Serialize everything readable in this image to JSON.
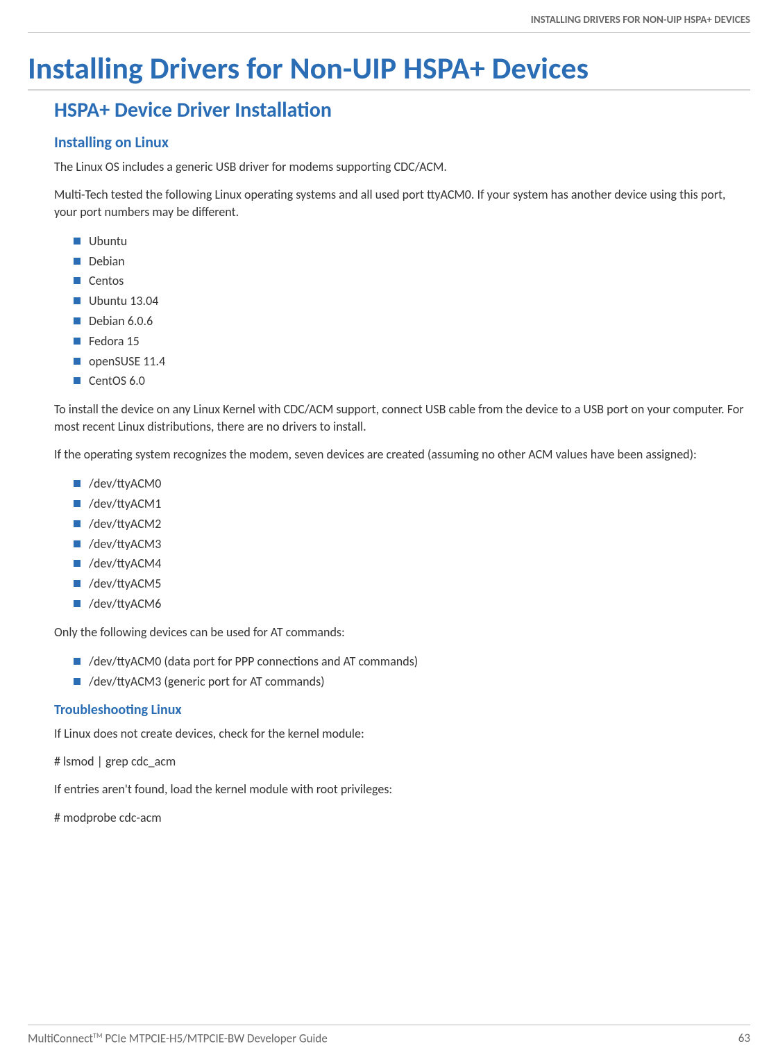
{
  "header": "INSTALLING DRIVERS FOR NON-UIP HSPA+ DEVICES",
  "title": "Installing Drivers for Non-UIP HSPA+ Devices",
  "section_heading": "HSPA+ Device Driver Installation",
  "subheading1": "Installing on Linux",
  "para1": "The Linux OS includes a generic USB driver for modems supporting CDC/ACM.",
  "para2": "Multi-Tech tested the following Linux operating systems and all used port ttyACM0. If your system has another device using this port, your port numbers may be different.",
  "os_list": [
    "Ubuntu",
    "Debian",
    "Centos",
    "Ubuntu 13.04",
    "Debian 6.0.6",
    "Fedora 15",
    "openSUSE 11.4",
    "CentOS 6.0"
  ],
  "para3": "To install the device on any Linux Kernel with CDC/ACM support, connect USB cable from the device to a USB port on your computer. For most recent Linux distributions, there are no drivers to install.",
  "para4": "If the operating system recognizes the modem, seven devices are created (assuming no other ACM values have been assigned):",
  "dev_list": [
    "/dev/ttyACM0",
    "/dev/ttyACM1",
    "/dev/ttyACM2",
    "/dev/ttyACM3",
    "/dev/ttyACM4",
    "/dev/ttyACM5",
    "/dev/ttyACM6"
  ],
  "para5": "Only the following devices can be used for AT commands:",
  "at_list": [
    "/dev/ttyACM0 (data port for PPP connections and AT commands)",
    "/dev/ttyACM3 (generic port for AT commands)"
  ],
  "subheading2": "Troubleshooting Linux",
  "para6": "If Linux does not create devices, check for the kernel module:",
  "cmd1": "#  lsmod  |  grep  cdc_acm",
  "para7": "If entries aren't found, load the kernel module with root privileges:",
  "cmd2": "#  modprobe  cdc-acm",
  "footer_left_prefix": "MultiConnect",
  "footer_left_suffix": " PCIe MTPCIE-H5/MTPCIE-BW Developer Guide",
  "footer_right": "63"
}
